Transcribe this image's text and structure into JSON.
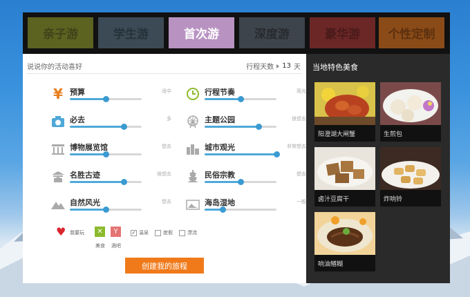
{
  "tabs": [
    {
      "label": "亲子游",
      "bg": "#5c6220",
      "fg": "#3f431a"
    },
    {
      "label": "学生游",
      "bg": "#3c4a55",
      "fg": "#26323a"
    },
    {
      "label": "首次游",
      "bg": "#b893c2",
      "fg": "#ffffff"
    },
    {
      "label": "深度游",
      "bg": "#3e444c",
      "fg": "#272b30"
    },
    {
      "label": "豪华游",
      "bg": "#6b2626",
      "fg": "#4a1a1a"
    },
    {
      "label": "个性定制",
      "bg": "#8a4b18",
      "fg": "#5b300f"
    }
  ],
  "prompt": "说说你的活动喜好",
  "trip_days": {
    "label": "行程天数",
    "value": "13",
    "unit": "天"
  },
  "prefs": [
    {
      "name": "预算",
      "value": "适中",
      "icon": "yen-icon",
      "level": 0.5,
      "color": "#e87f1e"
    },
    {
      "name": "行程节奏",
      "value": "观光",
      "icon": "clock-icon",
      "level": 0.5,
      "color": "#8cba2c"
    },
    {
      "name": "必去",
      "value": "多",
      "icon": "camera-icon",
      "level": 0.75,
      "color": "#4ea8d8"
    },
    {
      "name": "主题公园",
      "value": "很想去",
      "icon": "ferris-wheel-icon",
      "level": 0.75,
      "color": "#aaaaaa"
    },
    {
      "name": "博物展览馆",
      "value": "想去",
      "icon": "museum-icon",
      "level": 0.5,
      "color": "#aaaaaa"
    },
    {
      "name": "城市观光",
      "value": "非常想去",
      "icon": "city-icon",
      "level": 1.0,
      "color": "#aaaaaa"
    },
    {
      "name": "名胜古迹",
      "value": "很想去",
      "icon": "temple-icon",
      "level": 0.75,
      "color": "#aaaaaa"
    },
    {
      "name": "民俗宗教",
      "value": "想去",
      "icon": "pagoda-icon",
      "level": 0.5,
      "color": "#aaaaaa"
    },
    {
      "name": "自然风光",
      "value": "想去",
      "icon": "mountain-icon",
      "level": 0.5,
      "color": "#aaaaaa"
    },
    {
      "name": "海岛湿地",
      "value": "一般",
      "icon": "island-icon",
      "level": 0.25,
      "color": "#aaaaaa"
    }
  ],
  "want_label": "我要玩",
  "extras_icons": [
    {
      "label": "美食"
    },
    {
      "label": "酒吧"
    }
  ],
  "checkboxes": [
    {
      "label": "温泉",
      "checked": true
    },
    {
      "label": "度假",
      "checked": false
    },
    {
      "label": "漂流",
      "checked": false
    }
  ],
  "create_button": "创建我的旅程",
  "side_title": "当地特色美食",
  "foods": [
    {
      "label": "阳澄湖大闸蟹"
    },
    {
      "label": "生煎包"
    },
    {
      "label": "卤汁豆腐干"
    },
    {
      "label": "炸响铃"
    },
    {
      "label": "响油鳝糊"
    }
  ]
}
